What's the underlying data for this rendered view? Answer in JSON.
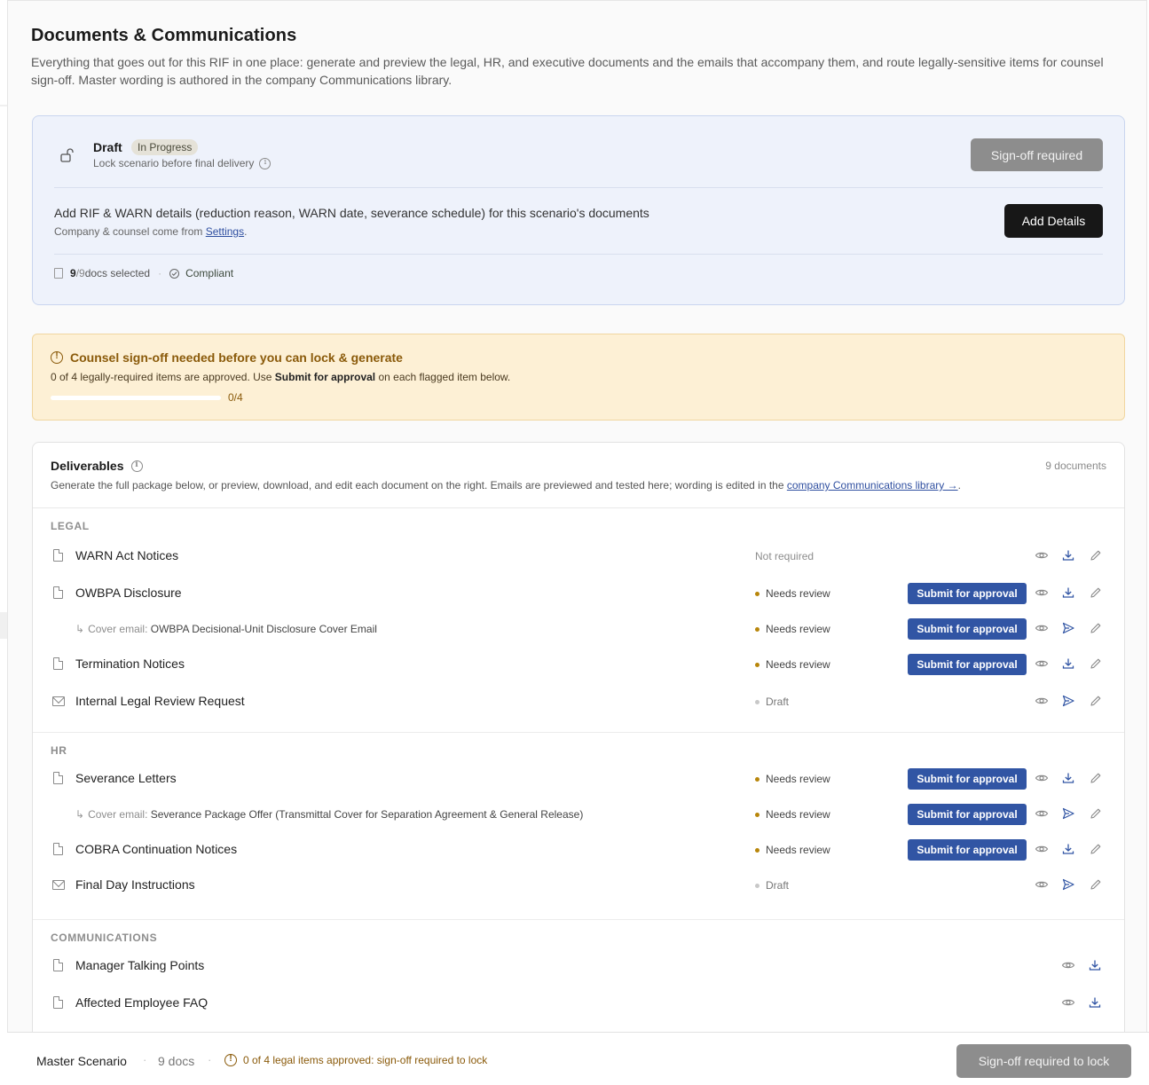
{
  "header": {
    "title": "Documents & Communications",
    "description": "Everything that goes out for this RIF in one place: generate and preview the legal, HR, and executive documents and the emails that accompany them, and route legally-sensitive items for counsel sign-off. Master wording is authored in the company Communications library."
  },
  "status_card": {
    "state_title": "Draft",
    "state_badge": "In Progress",
    "lock_hint": "Lock scenario before final delivery",
    "signoff_button": "Sign-off required",
    "details_text": "Add RIF & WARN details (reduction reason, WARN date, severance schedule) for this scenario's documents",
    "details_sub_prefix": "Company & counsel come from ",
    "details_sub_link": "Settings",
    "details_sub_suffix": ".",
    "add_details_button": "Add Details",
    "docs_selected_num": "9",
    "docs_selected_den": "/9",
    "docs_selected_label": " docs selected",
    "compliance": "Compliant"
  },
  "warning": {
    "title": "Counsel sign-off needed before you can lock & generate",
    "text_prefix": "0 of 4 legally-required items are approved. Use ",
    "text_bold": "Submit for approval",
    "text_suffix": " on each flagged item below.",
    "progress_label": "0/4",
    "progress_fraction": 0,
    "accent_color": "#8a5a0a"
  },
  "deliverables": {
    "title": "Deliverables",
    "count": "9 documents",
    "desc_prefix": "Generate the full package below, or preview, download, and edit each document on the right. Emails are previewed and tested here; wording is edited in the ",
    "desc_link": "company Communications library →",
    "desc_suffix": ".",
    "sections": [
      {
        "label": "LEGAL",
        "rows": [
          {
            "kind": "doc",
            "label": "WARN Act Notices",
            "status": "Not required"
          },
          {
            "kind": "doc",
            "label": "OWBPA Disclosure",
            "status": "Needs review",
            "submit": "Submit for approval"
          },
          {
            "kind": "cover",
            "prefix": "Cover email: ",
            "label": "OWBPA Decisional-Unit Disclosure Cover Email",
            "status": "Needs review",
            "submit": "Submit for approval"
          },
          {
            "kind": "doc",
            "label": "Termination Notices",
            "status": "Needs review",
            "submit": "Submit for approval"
          },
          {
            "kind": "email",
            "label": "Internal Legal Review Request",
            "status": "Draft"
          }
        ]
      },
      {
        "label": "HR",
        "rows": [
          {
            "kind": "doc",
            "label": "Severance Letters",
            "status": "Needs review",
            "submit": "Submit for approval"
          },
          {
            "kind": "cover",
            "prefix": "Cover email: ",
            "label": "Severance Package Offer (Transmittal Cover for Separation Agreement & General Release)",
            "status": "Needs review",
            "submit": "Submit for approval"
          },
          {
            "kind": "doc",
            "label": "COBRA Continuation Notices",
            "status": "Needs review",
            "submit": "Submit for approval"
          },
          {
            "kind": "email",
            "label": "Final Day Instructions",
            "status": "Draft"
          }
        ]
      },
      {
        "label": "COMMUNICATIONS",
        "rows": [
          {
            "kind": "doc",
            "label": "Manager Talking Points"
          },
          {
            "kind": "doc",
            "label": "Affected Employee FAQ"
          }
        ]
      }
    ],
    "status_colors": {
      "needs_review": "#b8860b",
      "draft": "#c8c8c8"
    },
    "submit_color": "#3155a4"
  },
  "bottom_bar": {
    "scenario": "Master Scenario",
    "docs": "9 docs",
    "warning": "0 of 4 legal items approved: sign-off required to lock",
    "lock_button": "Sign-off required to lock"
  },
  "icons": [
    "lock-open-icon",
    "info-icon",
    "document-icon",
    "check-circle-icon",
    "alert-circle-icon",
    "mail-icon",
    "eye-icon",
    "download-icon",
    "send-icon",
    "pencil-icon"
  ]
}
